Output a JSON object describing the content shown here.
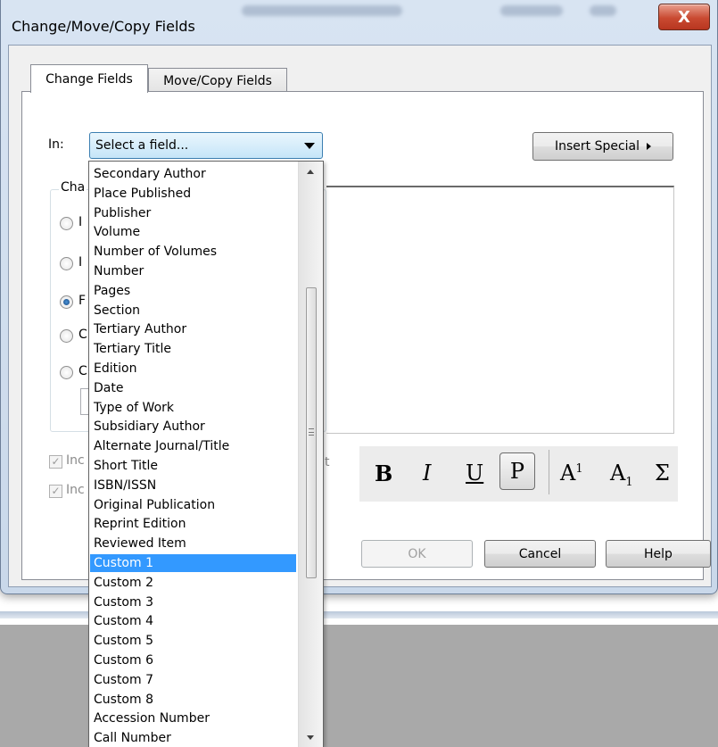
{
  "window": {
    "title": "Change/Move/Copy Fields",
    "close_glyph": "X"
  },
  "tabs": [
    {
      "label": "Change Fields",
      "active": true
    },
    {
      "label": "Move/Copy Fields",
      "active": false
    }
  ],
  "in_field": {
    "label": "In:",
    "value": "Select a field...",
    "options": [
      "Secondary Author",
      "Place Published",
      "Publisher",
      "Volume",
      "Number of Volumes",
      "Number",
      "Pages",
      "Section",
      "Tertiary Author",
      "Tertiary Title",
      "Edition",
      "Date",
      "Type of Work",
      "Subsidiary Author",
      "Alternate Journal/Title",
      "Short Title",
      "ISBN/ISSN",
      "Original Publication",
      "Reprint Edition",
      "Reviewed Item",
      "Custom 1",
      "Custom 2",
      "Custom 3",
      "Custom 4",
      "Custom 5",
      "Custom 6",
      "Custom 7",
      "Custom 8",
      "Accession Number",
      "Call Number"
    ],
    "highlighted": "Custom 1"
  },
  "insert_special": {
    "label": "Insert Special"
  },
  "change_group": {
    "label_visible": "Cha",
    "options_visible": [
      "I",
      "I",
      "F",
      "C",
      "C"
    ],
    "checked_index": 2
  },
  "include_checks": [
    {
      "label_visible": "Inc",
      "checked": true
    },
    {
      "label_visible": "Inc",
      "checked": true
    }
  ],
  "check_tail": "t",
  "format_toolbar": {
    "bold": "B",
    "italic": "I",
    "underline": "U",
    "plain": "P",
    "superscript_base": "A",
    "superscript_mark": "1",
    "subscript_base": "A",
    "subscript_mark": "1",
    "symbol": "Σ"
  },
  "buttons": {
    "ok": "OK",
    "cancel": "Cancel",
    "help": "Help"
  }
}
